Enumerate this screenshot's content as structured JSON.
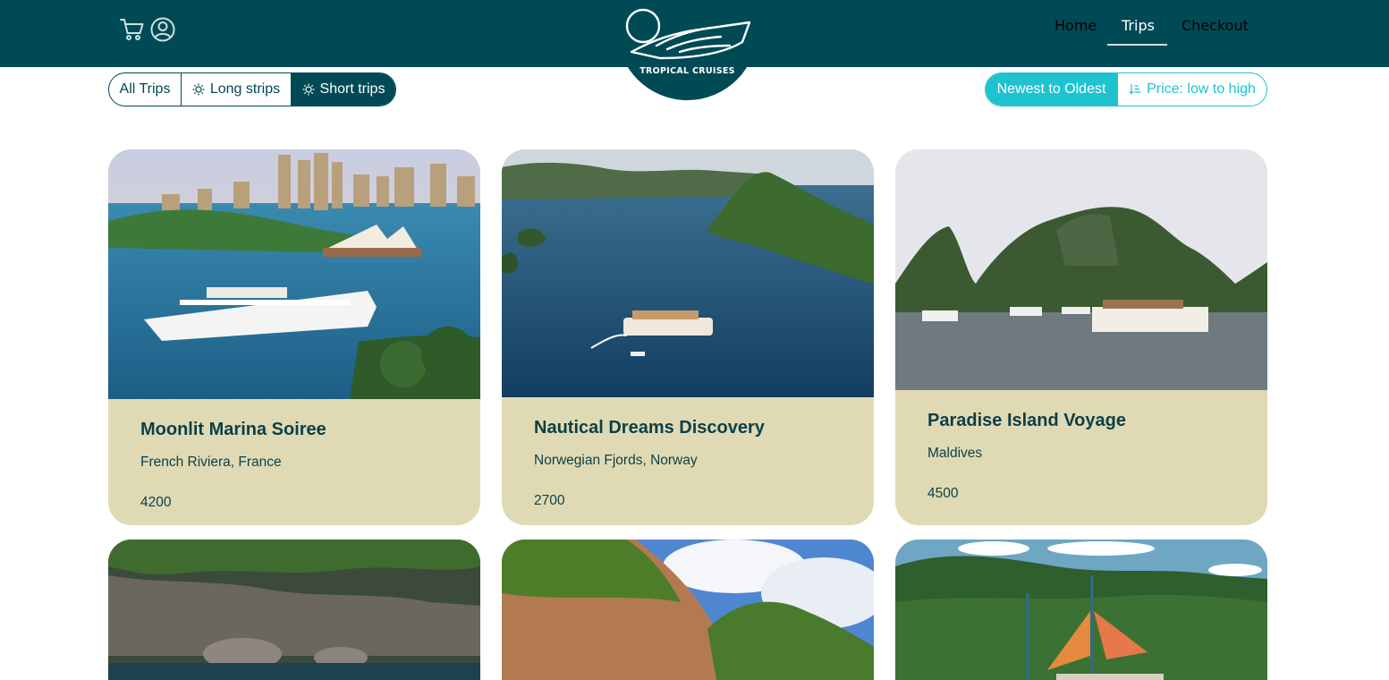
{
  "header": {
    "brand": "TROPICAL CRUISES",
    "icons": [
      "cart-icon",
      "user-icon"
    ],
    "nav": [
      {
        "label": "Home",
        "active": false
      },
      {
        "label": "Trips",
        "active": true
      },
      {
        "label": "Checkout",
        "active": false
      }
    ],
    "colors": {
      "bar": "#004a56",
      "accent": "#1ec3cf",
      "card": "#e0dab4"
    }
  },
  "filters": {
    "length": [
      {
        "label": "All Trips",
        "icon": "",
        "active": false
      },
      {
        "label": "Long strips",
        "icon": "sun-icon",
        "active": false
      },
      {
        "label": "Short trips",
        "icon": "sun-icon",
        "active": true
      }
    ],
    "sort": [
      {
        "label": "Newest to Oldest",
        "icon": "",
        "active": true
      },
      {
        "label": "Price: low to high",
        "icon": "sort-ascending-icon",
        "active": false
      }
    ]
  },
  "trips": [
    {
      "title": "Moonlit Marina Soiree",
      "location": "French Riviera, France",
      "price": "4200",
      "image": "cruise-ship-harbor-photo"
    },
    {
      "title": "Nautical Dreams Discovery",
      "location": "Norwegian Fjords, Norway",
      "price": "2700",
      "image": "bay-islands-boat-photo"
    },
    {
      "title": "Paradise Island Voyage",
      "location": "Maldives",
      "price": "4500",
      "image": "karst-islands-boats-photo"
    },
    {
      "title": "",
      "location": "",
      "price": "",
      "image": "rocky-coast-photo"
    },
    {
      "title": "",
      "location": "",
      "price": "",
      "image": "cliffs-sky-photo"
    },
    {
      "title": "",
      "location": "",
      "price": "",
      "image": "sailboat-jungle-photo"
    }
  ]
}
